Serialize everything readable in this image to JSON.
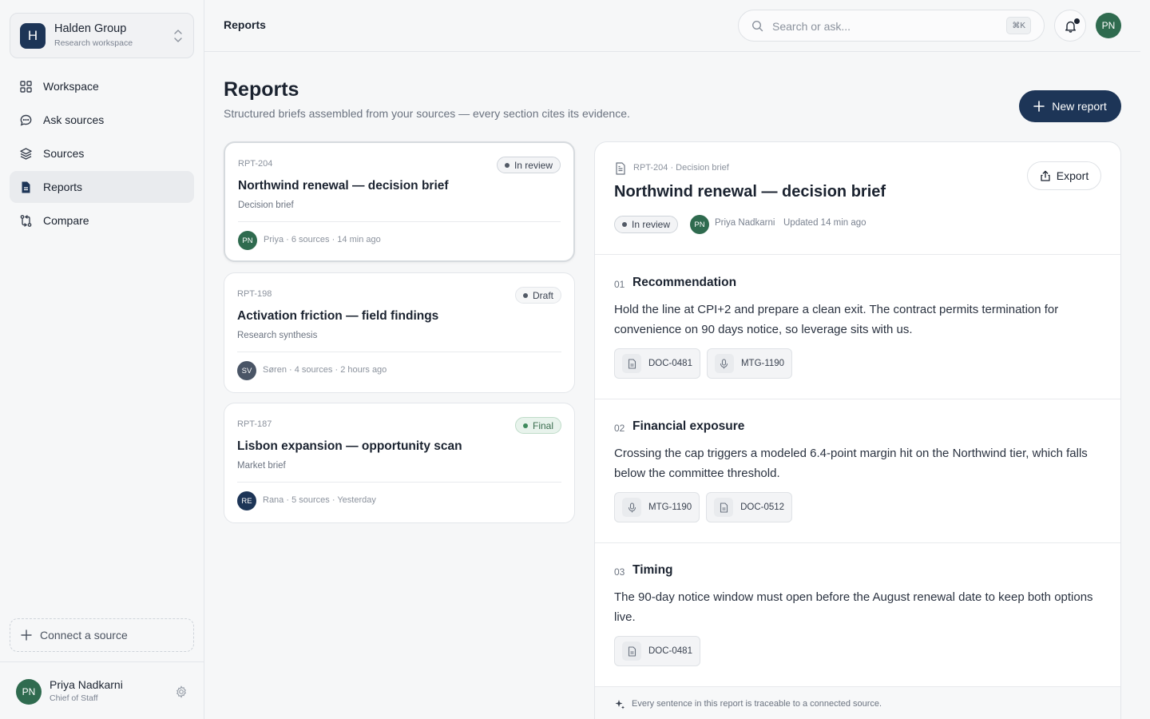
{
  "workspace": {
    "initial": "H",
    "name": "Halden Group",
    "subtitle": "Research workspace"
  },
  "nav": [
    {
      "label": "Workspace",
      "icon": "grid-icon",
      "active": false
    },
    {
      "label": "Ask sources",
      "icon": "chat-icon",
      "active": false
    },
    {
      "label": "Sources",
      "icon": "layers-icon",
      "active": false
    },
    {
      "label": "Reports",
      "icon": "document-icon",
      "active": true
    },
    {
      "label": "Compare",
      "icon": "compare-icon",
      "active": false
    }
  ],
  "connect_label": "Connect a source",
  "user": {
    "initials": "PN",
    "name": "Priya Nadkarni",
    "role": "Chief of Staff"
  },
  "topbar": {
    "breadcrumb": "Reports",
    "search_placeholder": "Search or ask...",
    "shortcut": "⌘K",
    "avatar_initials": "PN"
  },
  "page": {
    "title": "Reports",
    "subtitle": "Structured briefs assembled from your sources — every section cites its evidence.",
    "new_button": "New report"
  },
  "reports": [
    {
      "id": "RPT-204",
      "status": "In review",
      "title": "Northwind renewal — decision brief",
      "type": "Decision brief",
      "initials": "PN",
      "avatar_color": "#2f6b4f",
      "meta": "Priya · 6 sources · 14 min ago"
    },
    {
      "id": "RPT-198",
      "status": "Draft",
      "title": "Activation friction — field findings",
      "type": "Research synthesis",
      "initials": "SV",
      "avatar_color": "#4a5566",
      "meta": "Søren · 4 sources · 2 hours ago"
    },
    {
      "id": "RPT-187",
      "status": "Final",
      "title": "Lisbon expansion — opportunity scan",
      "type": "Market brief",
      "initials": "RE",
      "avatar_color": "#1d3557",
      "meta": "Rana · 5 sources · Yesterday"
    }
  ],
  "detail": {
    "id_line": "RPT-204 · Decision brief",
    "title": "Northwind renewal — decision brief",
    "export": "Export",
    "status": "In review",
    "author_initials": "PN",
    "author": "Priya Nadkarni",
    "updated": "Updated 14 min ago",
    "sections": [
      {
        "num": "01",
        "title": "Recommendation",
        "body": "Hold the line at CPI+2 and prepare a clean exit. The contract permits termination for convenience on 90 days notice, so leverage sits with us.",
        "citations": [
          {
            "kind": "doc",
            "label": "DOC-0481"
          },
          {
            "kind": "mic",
            "label": "MTG-1190"
          }
        ]
      },
      {
        "num": "02",
        "title": "Financial exposure",
        "body": "Crossing the cap triggers a modeled 6.4-point margin hit on the Northwind tier, which falls below the committee threshold.",
        "citations": [
          {
            "kind": "mic",
            "label": "MTG-1190"
          },
          {
            "kind": "doc",
            "label": "DOC-0512"
          }
        ]
      },
      {
        "num": "03",
        "title": "Timing",
        "body": "The 90-day notice window must open before the August renewal date to keep both options live.",
        "citations": [
          {
            "kind": "doc",
            "label": "DOC-0481"
          }
        ]
      }
    ],
    "footer": "Every sentence in this report is traceable to a connected source."
  }
}
